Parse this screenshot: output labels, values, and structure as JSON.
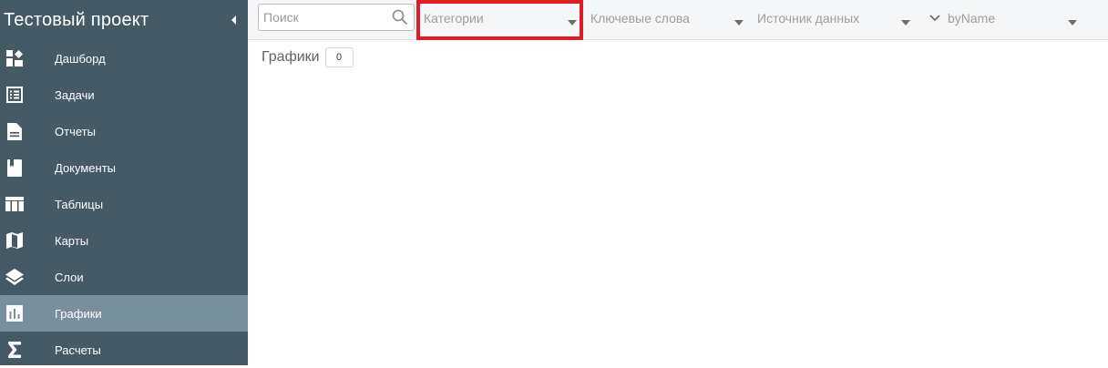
{
  "sidebar": {
    "title": "Тестовый проект",
    "collapse_icon": "caret-left-icon",
    "items": [
      {
        "label": "Дашборд",
        "icon": "dashboard-icon",
        "active": false
      },
      {
        "label": "Задачи",
        "icon": "task-list-icon",
        "active": false
      },
      {
        "label": "Отчеты",
        "icon": "report-icon",
        "active": false
      },
      {
        "label": "Документы",
        "icon": "document-icon",
        "active": false
      },
      {
        "label": "Таблицы",
        "icon": "table-icon",
        "active": false
      },
      {
        "label": "Карты",
        "icon": "map-icon",
        "active": false
      },
      {
        "label": "Слои",
        "icon": "layers-icon",
        "active": false
      },
      {
        "label": "Графики",
        "icon": "chart-icon",
        "active": true
      },
      {
        "label": "Расчеты",
        "icon": "sigma-icon",
        "active": false
      }
    ]
  },
  "toolbar": {
    "search": {
      "placeholder": "Поиск",
      "value": ""
    },
    "filters": {
      "categories": "Категории",
      "keywords": "Ключевые слова",
      "data_source": "Источник данных",
      "sort": "byName"
    }
  },
  "main": {
    "section_title": "Графики",
    "count": "0"
  },
  "colors": {
    "sidebar_bg": "#455a64",
    "sidebar_active": "#78909c",
    "highlight": "#e01b24",
    "toolbar_bg": "#f5f6f7"
  }
}
